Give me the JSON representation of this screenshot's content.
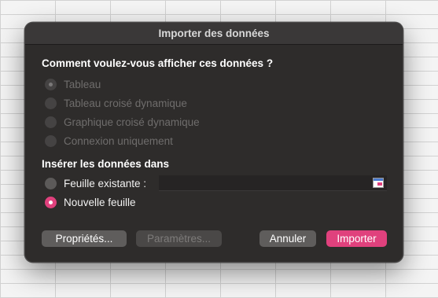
{
  "dialog": {
    "title": "Importer des données",
    "section_view": {
      "heading": "Comment voulez-vous afficher ces données ?",
      "options": [
        {
          "label": "Tableau",
          "selected": true,
          "enabled": false
        },
        {
          "label": "Tableau croisé dynamique",
          "selected": false,
          "enabled": false
        },
        {
          "label": "Graphique croisé dynamique",
          "selected": false,
          "enabled": false
        },
        {
          "label": "Connexion uniquement",
          "selected": false,
          "enabled": false
        }
      ]
    },
    "section_insert": {
      "heading": "Insérer les données dans",
      "options": [
        {
          "label": "Feuille existante :",
          "selected": false,
          "enabled": true
        },
        {
          "label": "Nouvelle feuille",
          "selected": true,
          "enabled": true
        }
      ],
      "range_value": ""
    },
    "buttons": {
      "properties": "Propriétés...",
      "parameters": "Paramètres...",
      "cancel": "Annuler",
      "import": "Importer"
    }
  },
  "colors": {
    "accent": "#e0417d",
    "dialog_bg": "#2e2c2b",
    "titlebar_bg": "#3a3838",
    "disabled_text": "#6f6d6c"
  },
  "icons": {
    "range_selector": "range-selector-icon"
  }
}
